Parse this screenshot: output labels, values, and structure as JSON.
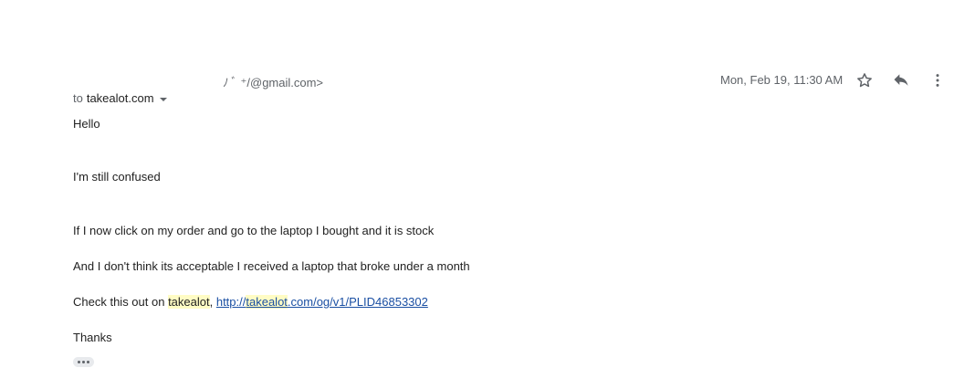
{
  "header": {
    "sender": "ﾉ ﾞ ⁺/@gmail.com>",
    "to_word": "to",
    "recipient": "takealot.com",
    "timestamp": "Mon, Feb 19, 11:30 AM",
    "icons": [
      "star-icon",
      "reply-icon",
      "more-vert-icon"
    ]
  },
  "body": {
    "greeting": "Hello",
    "line2": "I'm still confused",
    "line3": "If I now click on my order and go to the laptop I bought and it is stock",
    "line4": "And I don't think its acceptable I received a laptop that broke under a month",
    "line5_prefix": "Check this out on ",
    "line5_highlight": "takealot",
    "line5_sep": ", ",
    "link_text_pre": "http://",
    "link_text_hl": "takealot",
    "link_text_post": ".com/og/v1/PLID46853302",
    "closing": "Thanks"
  },
  "colors": {
    "highlight": "#fffcc4",
    "link": "#1a4fa3",
    "meta": "#5f6368"
  }
}
